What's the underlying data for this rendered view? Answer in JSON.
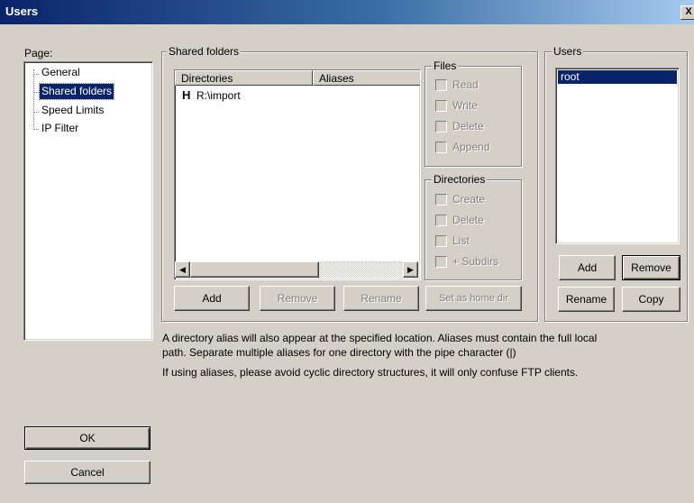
{
  "window": {
    "title": "Users",
    "close_glyph": "X"
  },
  "page_panel": {
    "label": "Page:",
    "items": [
      {
        "label": "General",
        "selected": false
      },
      {
        "label": "Shared folders",
        "selected": true
      },
      {
        "label": "Speed Limits",
        "selected": false
      },
      {
        "label": "IP Filter",
        "selected": false
      }
    ]
  },
  "shared_folders": {
    "group_label": "Shared folders",
    "columns": [
      "Directories",
      "Aliases"
    ],
    "rows": [
      {
        "flag": "H",
        "directory": "R:\\import",
        "alias": ""
      }
    ],
    "buttons": {
      "add": "Add",
      "remove": "Remove",
      "rename": "Rename",
      "set_home": "Set as home dir"
    }
  },
  "files_group": {
    "label": "Files",
    "options": [
      {
        "label": "Read",
        "checked": false
      },
      {
        "label": "Write",
        "checked": false
      },
      {
        "label": "Delete",
        "checked": false
      },
      {
        "label": "Append",
        "checked": false
      }
    ]
  },
  "directories_group": {
    "label": "Directories",
    "options": [
      {
        "label": "Create",
        "checked": false
      },
      {
        "label": "Delete",
        "checked": false
      },
      {
        "label": "List",
        "checked": false
      },
      {
        "label": "+ Subdirs",
        "checked": false
      }
    ]
  },
  "users_panel": {
    "group_label": "Users",
    "users": [
      "root"
    ],
    "selected_user": "root",
    "buttons": {
      "add": "Add",
      "remove": "Remove",
      "rename": "Rename",
      "copy": "Copy"
    }
  },
  "notes": {
    "line1": "A directory alias will also appear at the specified location. Aliases must contain the full local",
    "line2": "path. Separate multiple aliases for one directory with the pipe character (|)",
    "line3": "If using aliases, please avoid cyclic directory structures, it will only confuse FTP clients."
  },
  "dialog_buttons": {
    "ok": "OK",
    "cancel": "Cancel"
  },
  "colors": {
    "titlebar_start": "#0a246a",
    "titlebar_end": "#a6caf0",
    "selection": "#0a246a",
    "face": "#d4d0c8"
  }
}
